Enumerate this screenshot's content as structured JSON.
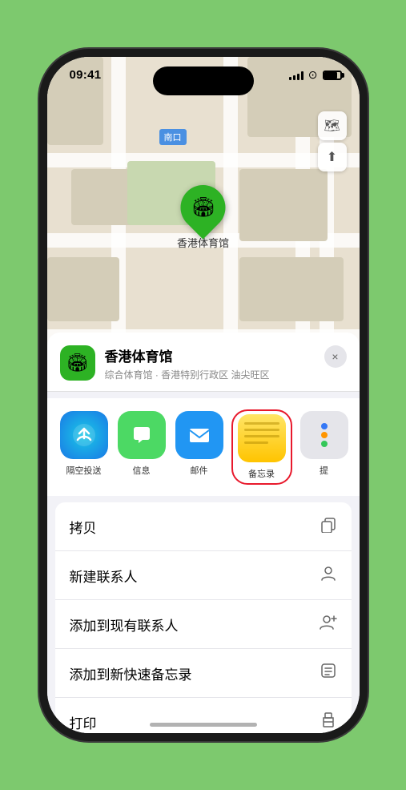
{
  "status": {
    "time": "09:41",
    "location_arrow": "▶"
  },
  "map": {
    "label": "南口"
  },
  "location": {
    "name": "香港体育馆",
    "subtitle": "综合体育馆 · 香港特别行政区 油尖旺区",
    "icon_emoji": "🏟"
  },
  "share_items": [
    {
      "id": "airdrop",
      "label": "隔空投送"
    },
    {
      "id": "messages",
      "label": "信息"
    },
    {
      "id": "mail",
      "label": "邮件"
    },
    {
      "id": "notes",
      "label": "备忘录"
    },
    {
      "id": "more",
      "label": "提"
    }
  ],
  "actions": [
    {
      "label": "拷贝",
      "icon": "copy"
    },
    {
      "label": "新建联系人",
      "icon": "person"
    },
    {
      "label": "添加到现有联系人",
      "icon": "person-add"
    },
    {
      "label": "添加到新快速备忘录",
      "icon": "note"
    },
    {
      "label": "打印",
      "icon": "print"
    }
  ],
  "close_label": "×"
}
